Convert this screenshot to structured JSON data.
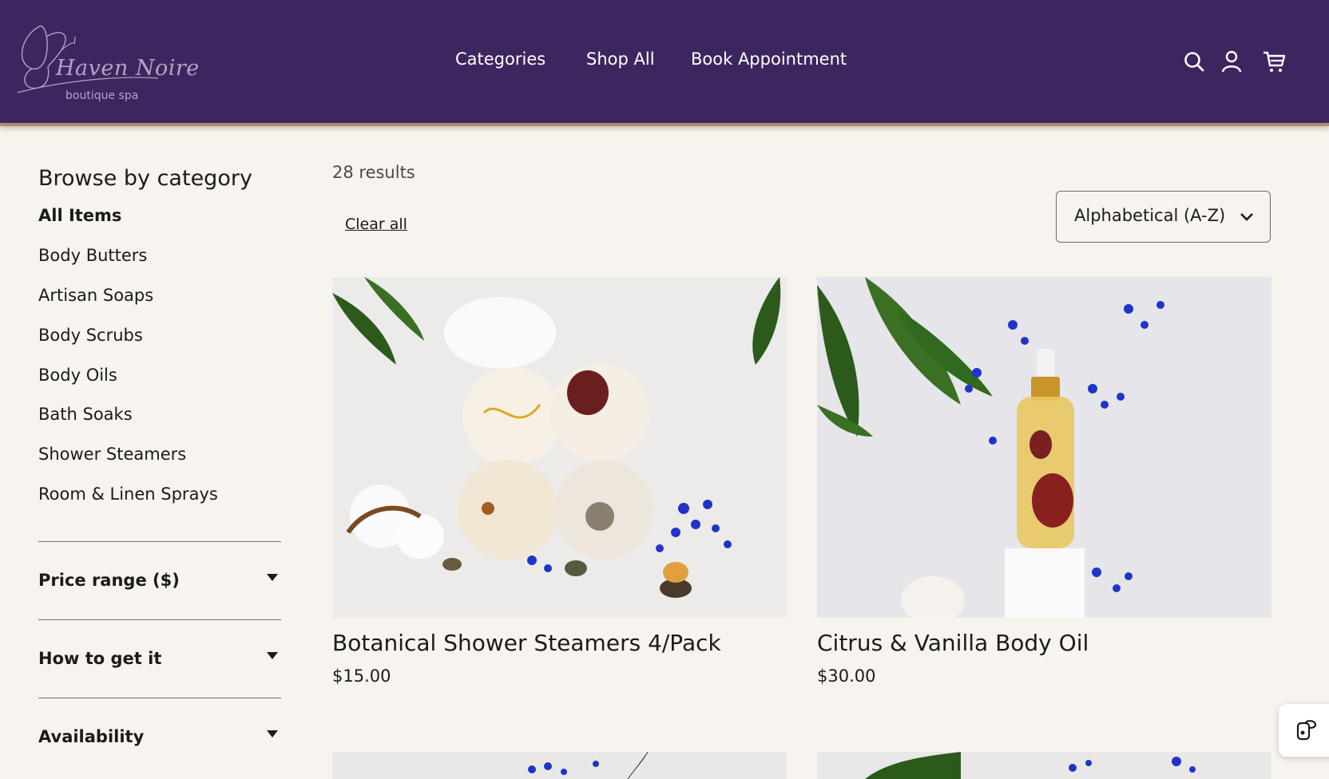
{
  "brand": {
    "name": "Haven Noire",
    "tagline": "boutique spa"
  },
  "nav": {
    "items": [
      "Categories",
      "Shop All",
      "Book Appointment"
    ]
  },
  "header_icons": [
    "search-icon",
    "account-icon",
    "cart-icon"
  ],
  "sidebar": {
    "title": "Browse by category",
    "categories": [
      "All Items",
      "Body Butters",
      "Artisan Soaps",
      "Body Scrubs",
      "Body Oils",
      "Bath Soaks",
      "Shower Steamers",
      "Room & Linen Sprays"
    ],
    "active_category": "All Items",
    "filters": [
      "Price range ($)",
      "How to get it",
      "Availability"
    ]
  },
  "main": {
    "results_text": "28 results",
    "clear_all": "Clear all",
    "sort": {
      "selected": "Alphabetical (A-Z)"
    },
    "products": [
      {
        "name": "Botanical Shower Steamers 4/Pack",
        "price": "$15.00"
      },
      {
        "name": "Citrus & Vanilla Body Oil",
        "price": "$30.00"
      }
    ]
  },
  "colors": {
    "header_bg": "#3d2660",
    "page_bg": "#f7f3ee",
    "accent_border": "#b38c63",
    "flower_blue": "#1f35c8",
    "leaf_green": "#2f6a1e"
  }
}
